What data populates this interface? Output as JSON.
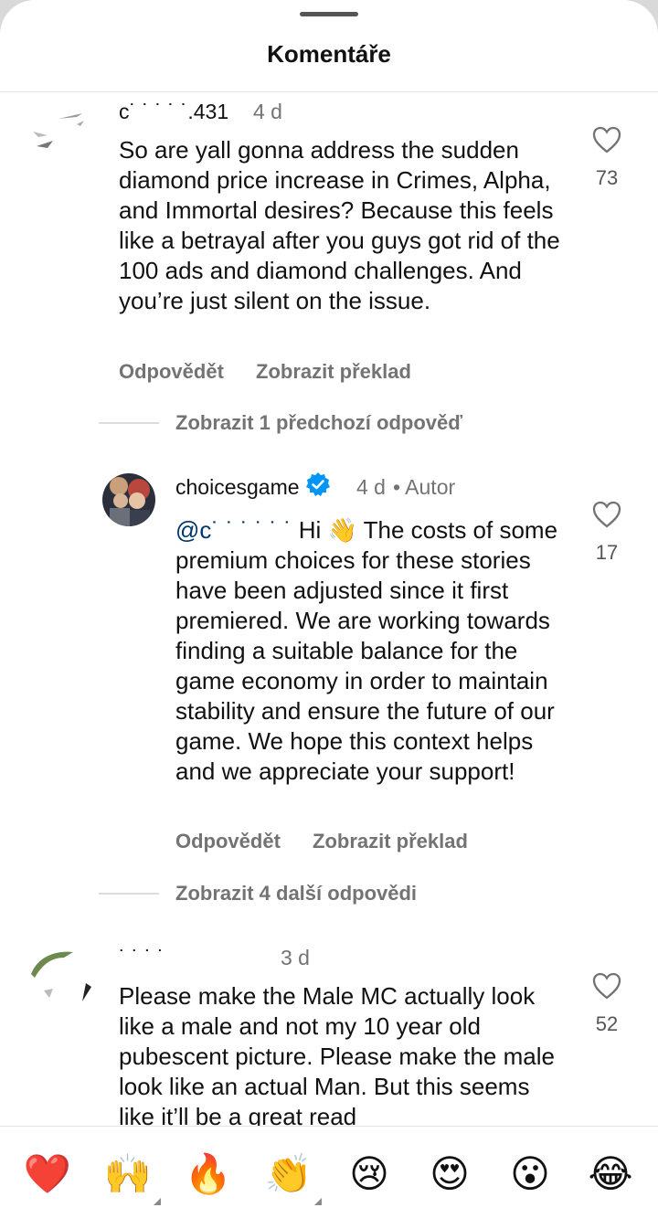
{
  "header": {
    "title": "Komentáře"
  },
  "comments": [
    {
      "username": "c˙ ˙ ˙ ˙ ˙.431",
      "time": "4 d",
      "text": "So are yall gonna address the sudden diamond price increase in Crimes, Alpha, and Immortal desires? Because this feels like a betrayal after you guys got rid of the 100 ads and diamond challenges. And you’re just silent on the issue.",
      "likes": "73",
      "reply_label": "Odpovědět",
      "translate_label": "Zobrazit překlad"
    },
    {
      "thread_label": "Zobrazit 1 předchozí odpověď"
    },
    {
      "username": "choicesgame",
      "time": "4 d",
      "author_label": "• Autor",
      "mention": "@c˙ ˙ ˙ ˙ ˙ ˙",
      "text": "Hi 👋 The costs of some premium choices for these stories have been adjusted since it first premiered. We are working towards finding a suitable balance for the game economy in order to maintain stability and ensure the future of our game. We hope this context helps and we appreciate your support!",
      "likes": "17",
      "reply_label": "Odpovědět",
      "translate_label": "Zobrazit překlad"
    },
    {
      "thread_label": "Zobrazit 4 další odpovědi"
    },
    {
      "username": "˙ ˙ ˙ ˙",
      "time": "3 d",
      "text": "Please make the Male MC actually look like a male and not my 10 year old pubescent picture. Please make the male look like an actual Man. But this seems like it’ll be a great read",
      "likes": "52"
    }
  ],
  "reactions": [
    {
      "icon": "red-heart",
      "glyph": "❤️"
    },
    {
      "icon": "raising-hands",
      "glyph": "🙌"
    },
    {
      "icon": "fire",
      "glyph": "🔥"
    },
    {
      "icon": "clapping-hands",
      "glyph": "👏"
    },
    {
      "icon": "crying-face",
      "glyph": "😢"
    },
    {
      "icon": "heart-eyes-face",
      "glyph": "😍"
    },
    {
      "icon": "surprised-face",
      "glyph": "😮"
    },
    {
      "icon": "tears-of-joy-face",
      "glyph": "😂"
    }
  ],
  "colors": {
    "mention": "#00376b",
    "verified": "#0095f6",
    "muted": "#737373"
  }
}
